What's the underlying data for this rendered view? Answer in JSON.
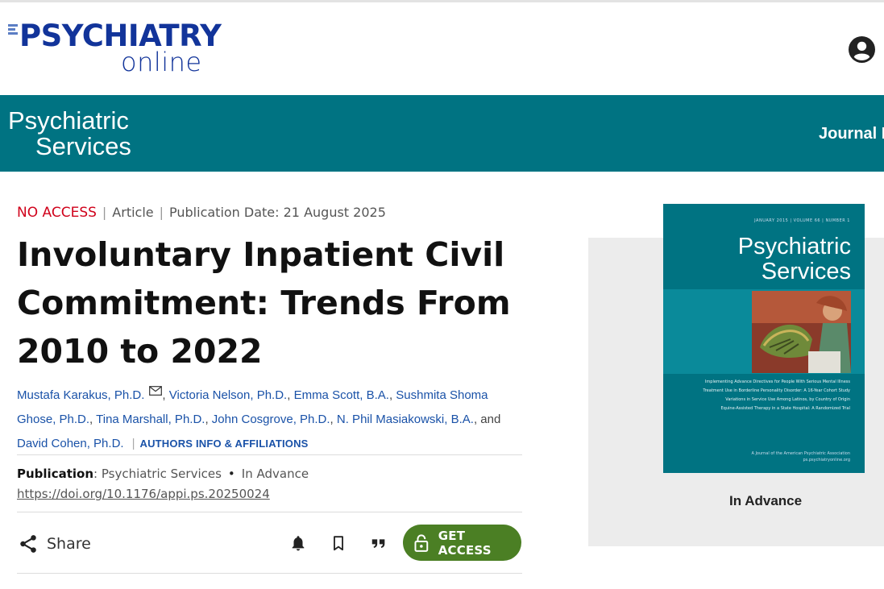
{
  "site": {
    "logo_main": "PSYCHIATRY",
    "logo_sub": "online",
    "account_icon": "account-circle-icon"
  },
  "journal": {
    "name_line1": "Psychiatric",
    "name_line2": "Services",
    "menu_label": "Journal N"
  },
  "article": {
    "access": "NO ACCESS",
    "type": "Article",
    "publication_date": "Publication Date: 21 August 2025",
    "title": "Involuntary Inpatient Civil Commitment: Trends From 2010 to 2022",
    "authors": [
      "Mustafa Karakus, Ph.D.",
      "Victoria Nelson, Ph.D.",
      "Emma Scott, B.A.",
      "Sushmita Shoma Ghose, Ph.D.",
      "Tina Marshall, Ph.D.",
      "John Cosgrove, Ph.D.",
      "N. Phil Masiakowski, B.A.",
      "David Cohen, Ph.D."
    ],
    "authors_sep": ", ",
    "authors_and": ", and ",
    "authors_info_link": "AUTHORS INFO & AFFILIATIONS",
    "publication_label": "Publication",
    "publication_colon": ": ",
    "publication_name": "Psychiatric Services",
    "publication_bullet": "•",
    "publication_status": "In Advance",
    "doi": "https://doi.org/10.1176/appi.ps.20250024"
  },
  "toolbar": {
    "share_label": "Share",
    "get_access_label": "GET ACCESS"
  },
  "cover": {
    "issue_line": "JANUARY 2015 | VOLUME 66 | NUMBER 1",
    "title_line1": "Psychiatric",
    "title_line2": "Services",
    "toc": [
      "Implementing Advance Directives for People With Serious Mental Illness",
      "Treatment Use in Borderline Personality Disorder: A 16-Year Cohort Study",
      "Variations in Service Use Among Latinos, by Country of Origin",
      "Equine-Assisted Therapy in a State Hospital: A Randomized Trial"
    ],
    "footer_line1": "A Journal of the American Psychiatric Association",
    "footer_line2": "ps.psychiatryonline.org",
    "caption": "In Advance"
  },
  "colors": {
    "brand_blue": "#12349a",
    "journal_teal": "#007382",
    "no_access_red": "#d0021b",
    "get_access_green": "#4b7f24",
    "link_blue": "#1a52a8"
  }
}
